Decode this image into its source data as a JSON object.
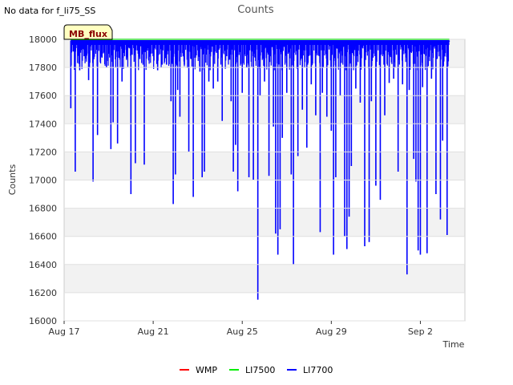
{
  "header": {
    "no_data_message": "No data for f_li75_SS"
  },
  "site_tag": "MB_flux",
  "chart_data": {
    "type": "line",
    "title": "Counts",
    "xlabel": "Time",
    "ylabel": "Counts",
    "ylim": [
      16000,
      18000
    ],
    "yticks": [
      16000,
      16200,
      16400,
      16600,
      16800,
      17000,
      17200,
      17400,
      17600,
      17800,
      18000
    ],
    "x_range_days": [
      0,
      18
    ],
    "xticks": [
      {
        "day": 0,
        "label": "Aug 17"
      },
      {
        "day": 4,
        "label": "Aug 21"
      },
      {
        "day": 8,
        "label": "Aug 25"
      },
      {
        "day": 12,
        "label": "Aug 29"
      },
      {
        "day": 16,
        "label": "Sep 2"
      }
    ],
    "grid": "horizontal bands",
    "legend_position": "bottom-center",
    "series": [
      {
        "name": "WMP",
        "color": "#ff0000",
        "values": []
      },
      {
        "name": "LI7500",
        "color": "#00ee00",
        "baseline": 18000,
        "x_range": [
          0.3,
          17.3
        ]
      },
      {
        "name": "LI7700",
        "color": "#0000ff",
        "baseline": 17990,
        "x_range": [
          0.3,
          17.3
        ],
        "dips": [
          [
            0.3,
            17510
          ],
          [
            0.5,
            17060
          ],
          [
            0.7,
            17780
          ],
          [
            0.9,
            17880
          ],
          [
            1.1,
            17710
          ],
          [
            1.3,
            16990
          ],
          [
            1.5,
            17320
          ],
          [
            1.7,
            17870
          ],
          [
            1.9,
            17800
          ],
          [
            2.1,
            17220
          ],
          [
            2.2,
            17410
          ],
          [
            2.4,
            17260
          ],
          [
            2.6,
            17700
          ],
          [
            2.8,
            17860
          ],
          [
            3.0,
            16900
          ],
          [
            3.2,
            17120
          ],
          [
            3.4,
            17860
          ],
          [
            3.6,
            17110
          ],
          [
            3.8,
            17850
          ],
          [
            4.0,
            17880
          ],
          [
            4.2,
            17780
          ],
          [
            4.4,
            17820
          ],
          [
            4.6,
            17820
          ],
          [
            4.8,
            17560
          ],
          [
            4.9,
            16830
          ],
          [
            5.0,
            17040
          ],
          [
            5.1,
            17640
          ],
          [
            5.2,
            17450
          ],
          [
            5.4,
            17820
          ],
          [
            5.6,
            17200
          ],
          [
            5.8,
            16880
          ],
          [
            5.9,
            17870
          ],
          [
            6.1,
            17770
          ],
          [
            6.2,
            17020
          ],
          [
            6.3,
            17060
          ],
          [
            6.5,
            17700
          ],
          [
            6.7,
            17650
          ],
          [
            6.9,
            17700
          ],
          [
            7.1,
            17420
          ],
          [
            7.3,
            17880
          ],
          [
            7.5,
            17560
          ],
          [
            7.6,
            17060
          ],
          [
            7.7,
            17250
          ],
          [
            7.8,
            16920
          ],
          [
            8.0,
            17620
          ],
          [
            8.2,
            17800
          ],
          [
            8.3,
            17020
          ],
          [
            8.5,
            17000
          ],
          [
            8.7,
            16150
          ],
          [
            8.8,
            17600
          ],
          [
            9.0,
            17700
          ],
          [
            9.2,
            17030
          ],
          [
            9.4,
            17380
          ],
          [
            9.5,
            16620
          ],
          [
            9.6,
            16470
          ],
          [
            9.7,
            16650
          ],
          [
            9.8,
            17300
          ],
          [
            10.0,
            17620
          ],
          [
            10.2,
            17040
          ],
          [
            10.3,
            16400
          ],
          [
            10.5,
            17170
          ],
          [
            10.7,
            17500
          ],
          [
            10.9,
            17230
          ],
          [
            11.1,
            17680
          ],
          [
            11.3,
            17460
          ],
          [
            11.5,
            16630
          ],
          [
            11.6,
            17620
          ],
          [
            11.8,
            17450
          ],
          [
            12.0,
            17350
          ],
          [
            12.1,
            16470
          ],
          [
            12.2,
            17020
          ],
          [
            12.4,
            17600
          ],
          [
            12.6,
            16600
          ],
          [
            12.7,
            16510
          ],
          [
            12.8,
            16740
          ],
          [
            12.9,
            17100
          ],
          [
            13.1,
            17650
          ],
          [
            13.3,
            17550
          ],
          [
            13.5,
            16530
          ],
          [
            13.7,
            16560
          ],
          [
            13.8,
            17560
          ],
          [
            14.0,
            16960
          ],
          [
            14.2,
            16860
          ],
          [
            14.4,
            17460
          ],
          [
            14.6,
            17690
          ],
          [
            14.8,
            17720
          ],
          [
            15.0,
            17060
          ],
          [
            15.2,
            17680
          ],
          [
            15.4,
            16330
          ],
          [
            15.5,
            17640
          ],
          [
            15.7,
            17150
          ],
          [
            15.8,
            16990
          ],
          [
            15.9,
            16500
          ],
          [
            16.0,
            16470
          ],
          [
            16.1,
            17660
          ],
          [
            16.3,
            16480
          ],
          [
            16.5,
            17720
          ],
          [
            16.7,
            16900
          ],
          [
            16.9,
            16720
          ],
          [
            17.0,
            17280
          ],
          [
            17.2,
            16610
          ]
        ]
      }
    ]
  }
}
